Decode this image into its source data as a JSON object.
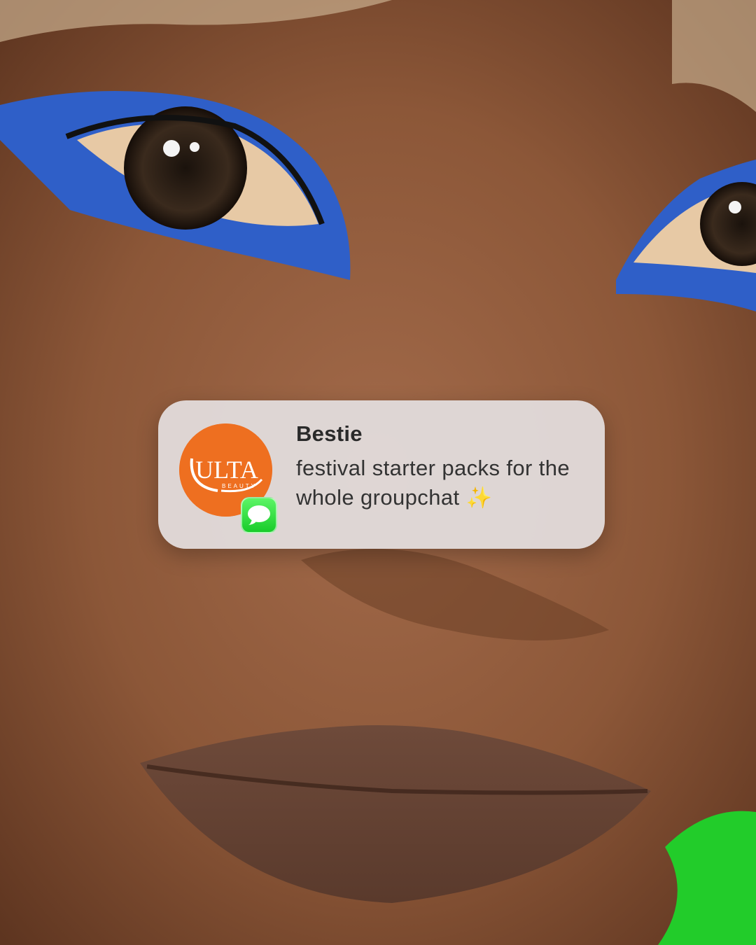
{
  "notification": {
    "app_icon": "ulta-beauty-logo",
    "app_icon_text": "ULTA",
    "app_icon_subtext": "BEAUTY",
    "badge_icon": "messages-app-icon",
    "sender": "Bestie",
    "message": "festival starter packs for the whole groupchat",
    "emoji": "✨"
  },
  "colors": {
    "eyeliner_blue": "#2f5fc8",
    "ulta_orange": "#ee6f20",
    "messages_green": "#2ed94a",
    "jacket_green": "#22cc2a"
  }
}
